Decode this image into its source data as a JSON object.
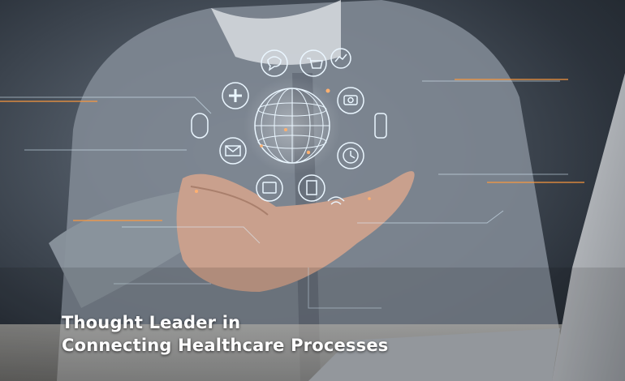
{
  "caption": {
    "line1": "Thought Leader in",
    "line2": "Connecting Healthcare Processes"
  },
  "colors": {
    "hologram": "#dff2ff",
    "accent_glow": "#ff9a3c",
    "sweater": "#8c95a0",
    "background_dark": "#1c2228"
  },
  "icons": [
    "plus-icon",
    "chat-icon",
    "cart-icon",
    "camera-icon",
    "clock-icon",
    "mail-icon",
    "tablet-icon",
    "document-icon",
    "globe-icon",
    "chart-icon",
    "pill-icon",
    "lock-icon",
    "wifi-icon"
  ]
}
